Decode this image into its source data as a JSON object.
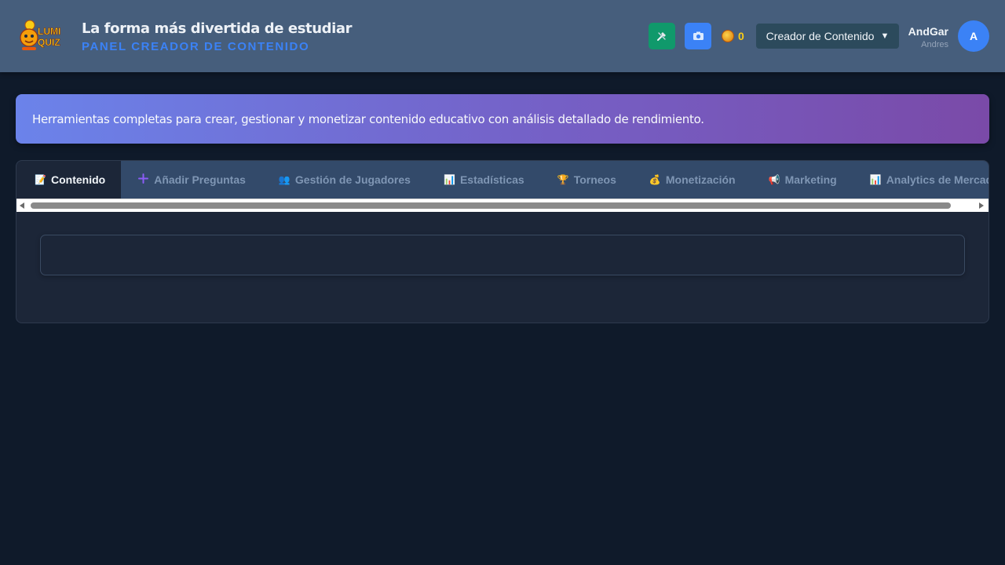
{
  "header": {
    "logo_text_top": "LUMI",
    "logo_text_bottom": "QUIZ",
    "title": "La forma más divertida de estudiar",
    "subtitle": "PANEL CREADOR DE CONTENIDO",
    "tools_icon": "tools-icon",
    "camera_icon": "camera-icon",
    "coins": "0",
    "role_selected": "Creador de Contenido",
    "role_arrow": "▼",
    "user_name": "AndGar",
    "user_fullname": "Andres",
    "avatar_initial": "A"
  },
  "banner": {
    "text": "Herramientas completas para crear, gestionar y monetizar contenido educativo con análisis detallado de rendimiento."
  },
  "tabs": [
    {
      "label": "Contenido",
      "icon": "📝",
      "icon_name": "document-icon",
      "active": true
    },
    {
      "label": "Añadir Preguntas",
      "icon": "➕",
      "icon_name": "plus-icon",
      "active": false
    },
    {
      "label": "Gestión de Jugadores",
      "icon": "👥",
      "icon_name": "users-icon",
      "active": false
    },
    {
      "label": "Estadísticas",
      "icon": "📊",
      "icon_name": "bar-chart-icon",
      "active": false
    },
    {
      "label": "Torneos",
      "icon": "🏆",
      "icon_name": "trophy-icon",
      "active": false
    },
    {
      "label": "Monetización",
      "icon": "💰",
      "icon_name": "money-bag-icon",
      "active": false
    },
    {
      "label": "Marketing",
      "icon": "📢",
      "icon_name": "megaphone-icon",
      "active": false
    },
    {
      "label": "Analytics de Mercado",
      "icon": "📊",
      "icon_name": "bar-chart-icon",
      "active": false
    }
  ],
  "colors": {
    "header_bg": "#465e7c",
    "accent_blue": "#3b82f6",
    "accent_green": "#10996b",
    "page_bg": "#0f1a2a",
    "banner_start": "#6b83ea",
    "banner_end": "#7a4aa8"
  }
}
